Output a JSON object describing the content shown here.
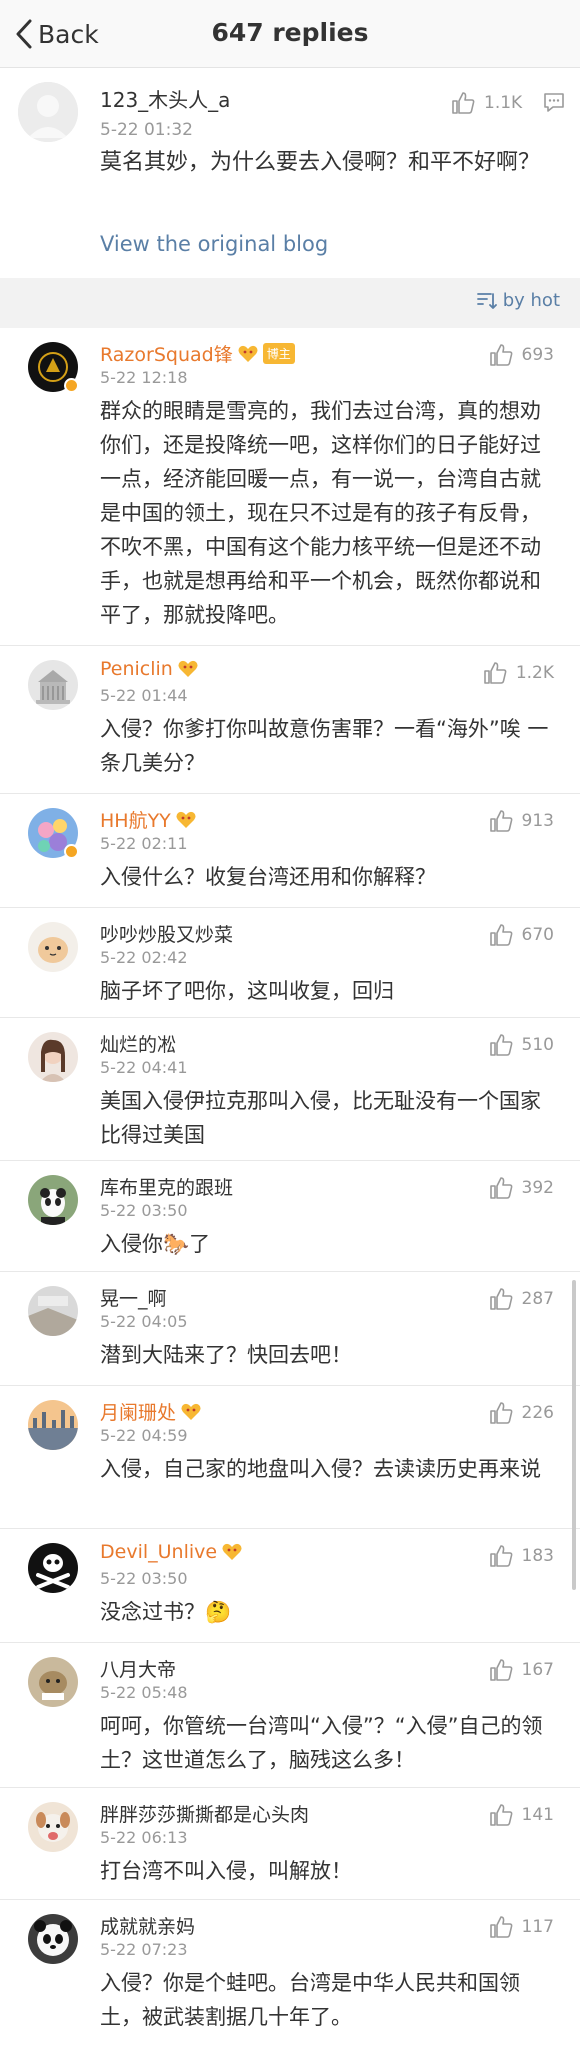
{
  "nav": {
    "back_label": "Back",
    "title": "647 replies"
  },
  "root": {
    "username": "123_木头人_a",
    "time": "5-22 01:32",
    "likes": "1.1K",
    "content": "莫名其妙，为什么要去入侵啊？和平不好啊？",
    "view_original": "View the original blog"
  },
  "sort": {
    "label": "by hot"
  },
  "badges": {
    "author_tag": "博主"
  },
  "colors": {
    "link": "#5a7fa6",
    "orange_name": "#e8792d",
    "verified": "#f5a623",
    "fan": "#e8792d"
  },
  "comments": [
    {
      "name": "RazorSquad锋",
      "time": "5-22 12:18",
      "likes": "693",
      "text": "群众的眼睛是雪亮的，我们去过台湾，真的想劝你们，还是投降统一吧，这样你们的日子能好过一点，经济能回暖一点，有一说一，台湾自古就是中国的领土，现在只不过是有的孩子有反骨，不吹不黑，中国有这个能力核平统一但是还不动手，也就是想再给和平一个机会，既然你都说和平了，那就投降吧。"
    },
    {
      "name": "Peniclin",
      "time": "5-22 01:44",
      "likes": "1.2K",
      "text": "入侵？你爹打你叫故意伤害罪？一看“海外”唉  一条几美分？"
    },
    {
      "name": "HH航YY",
      "time": "5-22 02:11",
      "likes": "913",
      "text": "入侵什么？收复台湾还用和你解释？"
    },
    {
      "name": "吵吵炒股又炒菜",
      "time": "5-22 02:42",
      "likes": "670",
      "text": "脑子坏了吧你，这叫收复，回归"
    },
    {
      "name": "灿烂的凇",
      "time": "5-22 04:41",
      "likes": "510",
      "text": "美国入侵伊拉克那叫入侵，比无耻没有一个国家比得过美国"
    },
    {
      "name": "库布里克的跟班",
      "time": "5-22 03:50",
      "likes": "392",
      "text": "入侵你🐎了"
    },
    {
      "name": "晃一_啊",
      "time": "5-22 04:05",
      "likes": "287",
      "text": "潜到大陆来了？快回去吧！"
    },
    {
      "name": "月阑珊处",
      "time": "5-22 04:59",
      "likes": "226",
      "text": "入侵，自己家的地盘叫入侵？去读读历史再来说"
    },
    {
      "name": "Devil_Unlive",
      "time": "5-22 03:50",
      "likes": "183",
      "text": "没念过书？🤔"
    },
    {
      "name": "八月大帝",
      "time": "5-22 05:48",
      "likes": "167",
      "text": "呵呵，你管统一台湾叫“入侵”？“入侵”自己的领土？这世道怎么了，脑残这么多！"
    },
    {
      "name": "胖胖莎莎撕撕都是心头肉",
      "time": "5-22 06:13",
      "likes": "141",
      "text": "打台湾不叫入侵，叫解放！"
    },
    {
      "name": "成就就亲妈",
      "time": "5-22 07:23",
      "likes": "117",
      "text": "入侵？你是个蛙吧。台湾是中华人民共和国领土，被武装割据几十年了。"
    }
  ]
}
